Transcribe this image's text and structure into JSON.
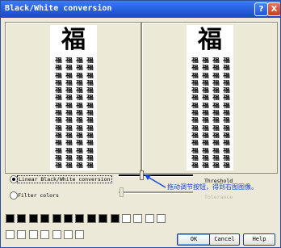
{
  "window": {
    "title": "Black/White conversion"
  },
  "titlebar_buttons": {
    "help": "?",
    "close": "X"
  },
  "preview": {
    "big_char": "福",
    "glyph_rows": [
      [
        "福",
        "福",
        "福",
        "福"
      ],
      [
        "福",
        "福",
        "福",
        "福"
      ],
      [
        "福",
        "福",
        "福",
        "福"
      ],
      [
        "福",
        "福",
        "福",
        "福"
      ],
      [
        "福",
        "福",
        "福",
        "福"
      ],
      [
        "福",
        "福",
        "福",
        "福"
      ],
      [
        "福",
        "福",
        "福",
        "福"
      ],
      [
        "福",
        "福",
        "福",
        "福"
      ],
      [
        "福",
        "福",
        "福",
        "福"
      ],
      [
        "福",
        "福",
        "福",
        "福"
      ],
      [
        "福",
        "福",
        "福",
        "福"
      ],
      [
        "福",
        "福",
        "福",
        "福"
      ],
      [
        "福",
        "福",
        "福",
        "福"
      ],
      [
        "福",
        "福",
        "福",
        "福"
      ],
      [
        "福",
        "福",
        "福",
        "福"
      ]
    ]
  },
  "options": {
    "linear_label": "Linear Black/White conversion",
    "filter_label": "Filter colors",
    "selected": "linear"
  },
  "sliders": {
    "threshold_label": "Threshold",
    "tolerance_label": "Tolerance",
    "threshold_level": 0.3
  },
  "annotation": {
    "text": "拖动调节按钮，得到右图图像。",
    "color": "#1746e0"
  },
  "swatches": [
    "#000000",
    "#000000",
    "#000000",
    "#000000",
    "#000000",
    "#000000",
    "#000000",
    "#000000",
    "#000000",
    "#000000",
    "#ffffff",
    "#ffffff",
    "#ffffff",
    "#ffffff",
    "#ffffff",
    "#ffffff",
    "#ffffff",
    "#ffffff",
    "#ffffff",
    "#ffffff",
    "#ffffff"
  ],
  "buttons": {
    "ok": "OK",
    "cancel": "Cancel",
    "help": "Help"
  }
}
